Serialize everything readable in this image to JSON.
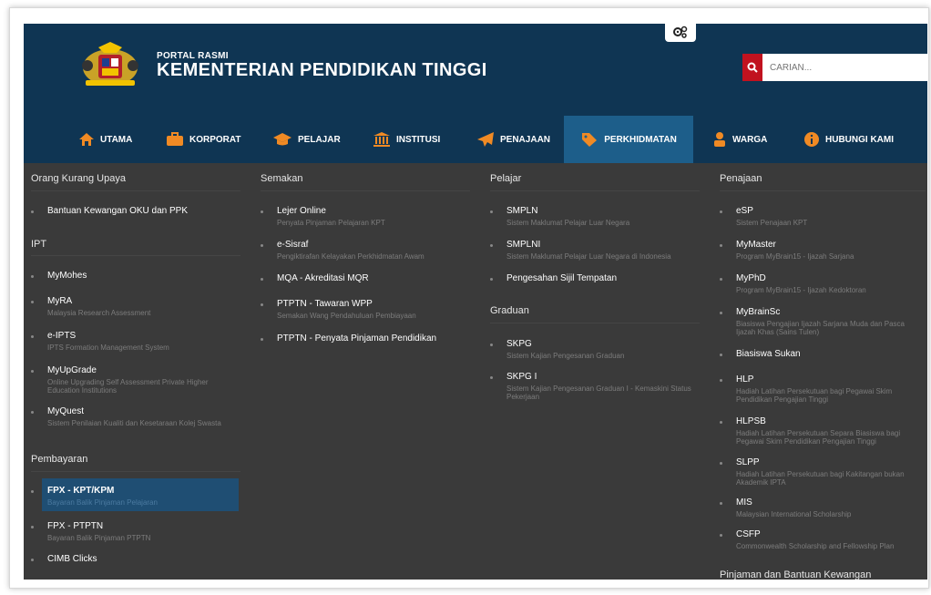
{
  "header": {
    "portal_small": "PORTAL RASMI",
    "portal_title": "KEMENTERIAN PENDIDIKAN TINGGI",
    "search_placeholder": "CARIAN..."
  },
  "colors": {
    "header_bg": "#0f3553",
    "nav_active": "#1d5e8a",
    "menu_bg": "#3a3a3a",
    "search_btn": "#c1121f",
    "icon_orange": "#f08a24"
  },
  "nav": [
    {
      "label": "UTAMA",
      "icon": "home-icon"
    },
    {
      "label": "KORPORAT",
      "icon": "briefcase-icon"
    },
    {
      "label": "PELAJAR",
      "icon": "graduation-cap-icon"
    },
    {
      "label": "INSTITUSI",
      "icon": "institution-icon"
    },
    {
      "label": "PENAJAAN",
      "icon": "paper-plane-icon"
    },
    {
      "label": "PERKHIDMATAN",
      "icon": "tag-icon"
    },
    {
      "label": "WARGA",
      "icon": "users-icon"
    },
    {
      "label": "HUBUNGI KAMI",
      "icon": "info-icon"
    }
  ],
  "menu": {
    "col1": {
      "sections": [
        {
          "title": "Orang Kurang Upaya",
          "items": [
            {
              "title": "Bantuan Kewangan OKU dan PPK",
              "sub": ""
            }
          ]
        },
        {
          "title": "IPT",
          "items": [
            {
              "title": "MyMohes",
              "sub": ""
            },
            {
              "title": "MyRA",
              "sub": "Malaysia Research Assessment"
            },
            {
              "title": "e-IPTS",
              "sub": "IPTS Formation Management System"
            },
            {
              "title": "MyUpGrade",
              "sub": "Online Upgrading Self Assessment Private Higher Education Institutions"
            },
            {
              "title": "MyQuest",
              "sub": "Sistem Penilaian Kualiti dan Kesetaraan Kolej Swasta"
            }
          ]
        },
        {
          "title": "Pembayaran",
          "items": [
            {
              "title": "FPX - KPT/KPM",
              "sub": "Bayaran Balik Pinjaman Pelajaran"
            },
            {
              "title": "FPX - PTPTN",
              "sub": "Bayaran Balik Pinjaman PTPTN"
            },
            {
              "title": "CIMB Clicks",
              "sub": ""
            }
          ]
        }
      ]
    },
    "col2": {
      "sections": [
        {
          "title": "Semakan",
          "items": [
            {
              "title": "Lejer Online",
              "sub": "Penyata Pinjaman Pelajaran KPT"
            },
            {
              "title": "e-Sisraf",
              "sub": "Pengiktirafan Kelayakan Perkhidmatan Awam"
            },
            {
              "title": "MQA - Akreditasi MQR",
              "sub": ""
            },
            {
              "title": "PTPTN - Tawaran WPP",
              "sub": "Semakan Wang Pendahuluan Pembiayaan"
            },
            {
              "title": "PTPTN - Penyata Pinjaman Pendidikan",
              "sub": ""
            }
          ]
        }
      ]
    },
    "col3": {
      "sections": [
        {
          "title": "Pelajar",
          "items": [
            {
              "title": "SMPLN",
              "sub": "Sistem Maklumat Pelajar Luar Negara"
            },
            {
              "title": "SMPLNI",
              "sub": "Sistem Maklumat Pelajar Luar Negara di Indonesia"
            },
            {
              "title": "Pengesahan Sijil Tempatan",
              "sub": ""
            }
          ]
        },
        {
          "title": "Graduan",
          "items": [
            {
              "title": "SKPG",
              "sub": "Sistem Kajian Pengesanan Graduan"
            },
            {
              "title": "SKPG I",
              "sub": "Sistem Kajian Pengesanan Graduan I - Kemaskini Status Pekerjaan"
            }
          ]
        }
      ]
    },
    "col4": {
      "sections": [
        {
          "title": "Penajaan",
          "items": [
            {
              "title": "eSP",
              "sub": "Sistem Penajaan KPT"
            },
            {
              "title": "MyMaster",
              "sub": "Program MyBrain15 - Ijazah Sarjana"
            },
            {
              "title": "MyPhD",
              "sub": "Program MyBrain15 - Ijazah Kedoktoran"
            },
            {
              "title": "MyBrainSc",
              "sub": "Biasiswa Pengajian Ijazah Sarjana Muda dan Pasca Ijazah Khas (Sains Tulen)"
            },
            {
              "title": "Biasiswa Sukan",
              "sub": ""
            },
            {
              "title": "HLP",
              "sub": "Hadiah Latihan Persekutuan bagi Pegawai Skim Pendidikan Pengajian Tinggi"
            },
            {
              "title": "HLPSB",
              "sub": "Hadiah Latihan Persekutuan Separa Biasiswa bagi Pegawai Skim Pendidikan Pengajian Tinggi"
            },
            {
              "title": "SLPP",
              "sub": "Hadiah Latihan Persekutuan bagi Kakitangan bukan Akademik IPTA"
            },
            {
              "title": "MIS",
              "sub": "Malaysian International Scholarship"
            },
            {
              "title": "CSFP",
              "sub": "Commonwealth Scholarship and Fellowship Plan"
            }
          ]
        },
        {
          "title": "Pinjaman dan Bantuan Kewangan",
          "items": []
        }
      ]
    }
  }
}
